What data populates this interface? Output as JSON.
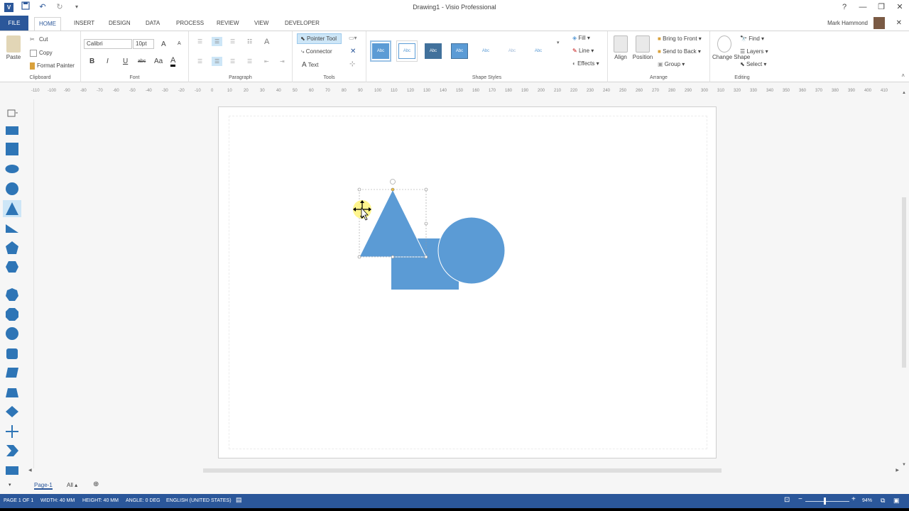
{
  "window": {
    "title": "Drawing1 - Visio Professional",
    "controls": {
      "help": "?",
      "minimize": "—",
      "restore": "❐",
      "close": "✕"
    }
  },
  "qat": {
    "logo": "V",
    "save": "💾",
    "undo": "↶",
    "redo": "↻",
    "customize": "▾"
  },
  "tabs": {
    "file": "FILE",
    "items": [
      "HOME",
      "INSERT",
      "DESIGN",
      "DATA",
      "PROCESS",
      "REVIEW",
      "VIEW",
      "DEVELOPER"
    ]
  },
  "user": {
    "name": "Mark Hammond"
  },
  "ribbon": {
    "clipboard": {
      "label": "Clipboard",
      "paste": "Paste",
      "cut": "Cut",
      "copy": "Copy",
      "format_painter": "Format Painter"
    },
    "font": {
      "label": "Font",
      "family": "Calibri",
      "size": "10pt",
      "bold": "B",
      "italic": "I",
      "underline": "U",
      "strike": "abc",
      "case": "Aa",
      "color": "A",
      "grow": "A",
      "shrink": "A"
    },
    "paragraph": {
      "label": "Paragraph"
    },
    "tools": {
      "label": "Tools",
      "pointer": "Pointer Tool",
      "connector": "Connector",
      "text": "Text"
    },
    "shape_styles": {
      "label": "Shape Styles",
      "style_text": "Abc",
      "fill": "Fill",
      "line": "Line",
      "effects": "Effects"
    },
    "arrange": {
      "label": "Arrange",
      "align": "Align",
      "position": "Position",
      "bring_front": "Bring to Front",
      "send_back": "Send to Back",
      "group": "Group"
    },
    "editing": {
      "label": "Editing",
      "change_shape": "Change Shape",
      "find": "Find",
      "layers": "Layers",
      "select": "Select"
    }
  },
  "ruler": {
    "ticks": [
      "-110",
      "-100",
      "-90",
      "-80",
      "-70",
      "-60",
      "-50",
      "-40",
      "-30",
      "-20",
      "-10",
      "0",
      "10",
      "20",
      "30",
      "40",
      "50",
      "60",
      "70",
      "80",
      "90",
      "100",
      "110",
      "120",
      "130",
      "140",
      "150",
      "160",
      "170",
      "180",
      "190",
      "200",
      "210",
      "220",
      "230",
      "240",
      "250",
      "260",
      "270",
      "280",
      "290",
      "300",
      "310",
      "320",
      "330",
      "340",
      "350",
      "360",
      "370",
      "380",
      "390",
      "400",
      "410"
    ]
  },
  "colors": {
    "shape": "#5b9bd5",
    "accent": "#2b579a"
  },
  "page_tabs": {
    "page1": "Page-1",
    "all": "All"
  },
  "status": {
    "page": "PAGE 1 OF 1",
    "width": "WIDTH: 40 MM",
    "height": "HEIGHT: 40 MM",
    "angle": "ANGLE: 0 DEG",
    "language": "ENGLISH (UNITED STATES)",
    "zoom": "94%"
  }
}
